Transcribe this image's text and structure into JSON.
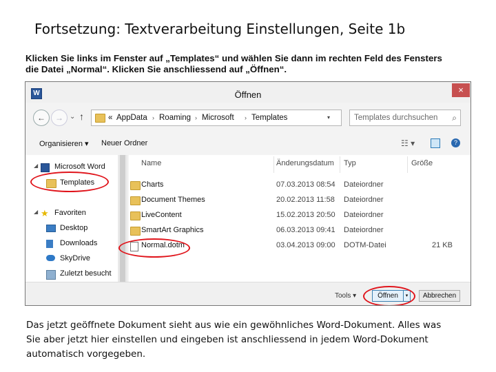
{
  "slide": {
    "title": "Fortsetzung: Textverarbeitung Einstellungen, Seite 1b",
    "instruction_lines": [
      "Klicken Sie links im Fenster auf „Templates“ und wählen Sie dann im rechten Feld des Fensters",
      "die Datei „Normal“. Klicken Sie anschliessend auf „Öffnen“."
    ],
    "bottom_lines": [
      "Das jetzt geöffnete Dokument sieht aus wie ein gewöhnliches Word-Dokument. Alles was",
      "Sie aber jetzt hier einstellen und eingeben ist anschliessend in jedem Word-Dokument",
      "automatisch vorgegeben."
    ]
  },
  "dialog": {
    "title": "Öffnen",
    "app_icon_letter": "W",
    "close_glyph": "×",
    "nav": {
      "back": "←",
      "forward": "→",
      "up": "↑",
      "chevron": "⌄"
    },
    "breadcrumb": [
      "«",
      "AppData",
      "Roaming",
      "Microsoft",
      "Templates"
    ],
    "refresh_glyph": "↻",
    "search_placeholder": "Templates durchsuchen",
    "search_icon": "⌕",
    "toolbar": {
      "organize": "Organisieren ▾",
      "new_folder": "Neuer Ordner",
      "view_glyph": "☷ ▾",
      "help_glyph": "?"
    },
    "nav_pane": {
      "items": [
        {
          "label": "Microsoft Word",
          "icon": "word-icon"
        },
        {
          "label": "Templates",
          "icon": "folder-icon"
        },
        {
          "label": "Favoriten",
          "icon": "star-icon"
        },
        {
          "label": "Desktop",
          "icon": "desktop-icon"
        },
        {
          "label": "Downloads",
          "icon": "downloads-icon"
        },
        {
          "label": "SkyDrive",
          "icon": "cloud-icon"
        },
        {
          "label": "Zuletzt besucht",
          "icon": "recent-icon"
        }
      ],
      "expand_glyph": "◢"
    },
    "columns": [
      "Name",
      "Änderungsdatum",
      "Typ",
      "Größe"
    ],
    "files": [
      {
        "name": "Charts",
        "date": "07.03.2013 08:54",
        "type": "Dateiordner",
        "size": "",
        "icon": "folder-icon"
      },
      {
        "name": "Document Themes",
        "date": "20.02.2013 11:58",
        "type": "Dateiordner",
        "size": "",
        "icon": "folder-icon"
      },
      {
        "name": "LiveContent",
        "date": "15.02.2013 20:50",
        "type": "Dateiordner",
        "size": "",
        "icon": "folder-icon"
      },
      {
        "name": "SmartArt Graphics",
        "date": "06.03.2013 09:41",
        "type": "Dateiordner",
        "size": "",
        "icon": "folder-icon"
      },
      {
        "name": "Normal.dotm",
        "date": "03.04.2013 09:00",
        "type": "DOTM-Datei",
        "size": "21 KB",
        "icon": "document-icon"
      }
    ],
    "bottom": {
      "tools": "Tools ▾",
      "open": "Öffnen",
      "open_dropdown": "▾",
      "cancel": "Abbrechen"
    }
  },
  "annotation_color": "#e0141b"
}
